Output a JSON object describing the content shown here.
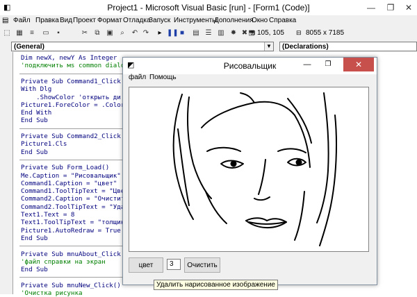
{
  "window": {
    "title": "Project1 - Microsoft Visual Basic [run] - [Form1 (Code)]",
    "controls": {
      "minimize": "—",
      "restore": "❐",
      "close": "✕"
    }
  },
  "menu": [
    "Файл",
    "Правка",
    "Вид",
    "Проект",
    "Формат",
    "Отладка",
    "Запуск",
    "Инструменты",
    "Дополнения",
    "Окно",
    "Справка"
  ],
  "toolbar": {
    "icons": [
      "vb-icon",
      "add-form-icon",
      "menu-editor-icon",
      "open-icon",
      "save-icon",
      "cut-icon",
      "copy-icon",
      "paste-icon",
      "find-icon",
      "undo-icon",
      "redo-icon",
      "start-icon",
      "break-icon",
      "end-icon",
      "project-explorer-icon",
      "properties-icon",
      "form-layout-icon",
      "object-browser-icon",
      "toolbox-icon",
      "data-view-icon"
    ],
    "position": "105, 105",
    "size": "8055 x 7185"
  },
  "code_window": {
    "object_combo": "(General)",
    "proc_combo": "(Declarations)",
    "lines": [
      {
        "text": "Dim newX, newY As Integer",
        "type": "code"
      },
      {
        "text": "'подключить мs common dialo",
        "type": "comment"
      },
      {
        "text": "",
        "type": "sep"
      },
      {
        "text": "Private Sub Command1_Click",
        "type": "code"
      },
      {
        "text": "With Dlg",
        "type": "code"
      },
      {
        "text": "    .ShowColor 'открыть ди",
        "type": "code"
      },
      {
        "text": "Picture1.ForeColor = .Color",
        "type": "code"
      },
      {
        "text": "End With",
        "type": "code"
      },
      {
        "text": "End Sub",
        "type": "code"
      },
      {
        "text": "",
        "type": "sep"
      },
      {
        "text": "Private Sub Command2_Click",
        "type": "code"
      },
      {
        "text": "Picture1.Cls",
        "type": "code"
      },
      {
        "text": "End Sub",
        "type": "code"
      },
      {
        "text": "",
        "type": "sep"
      },
      {
        "text": "Private Sub Form_Load()",
        "type": "code"
      },
      {
        "text": "Me.Caption = \"Рисовальщик\"",
        "type": "code"
      },
      {
        "text": "Command1.Caption = \"цвет\"",
        "type": "code"
      },
      {
        "text": "Command1.ToolTipText = \"Цве",
        "type": "code"
      },
      {
        "text": "Command2.Caption = \"Очистит",
        "type": "code"
      },
      {
        "text": "Command2.ToolTipText = \"Уда",
        "type": "code"
      },
      {
        "text": "Text1.Text = 8",
        "type": "code"
      },
      {
        "text": "Text1.ToolTipText = \"толщин",
        "type": "code"
      },
      {
        "text": "Picture1.AutoRedraw = True",
        "type": "code"
      },
      {
        "text": "End Sub",
        "type": "code"
      },
      {
        "text": "",
        "type": "sep"
      },
      {
        "text": "Private Sub mnuAbout_Click",
        "type": "code"
      },
      {
        "text": "'файл справки на экран",
        "type": "comment"
      },
      {
        "text": "End Sub",
        "type": "code"
      },
      {
        "text": "",
        "type": "sep"
      },
      {
        "text": "Private Sub mnuNew_Click()",
        "type": "code"
      },
      {
        "text": "'Очистка рисунка",
        "type": "comment"
      }
    ]
  },
  "form": {
    "title": "Рисовальщик",
    "menu": [
      "файл",
      "Помощь"
    ],
    "color_button": "цвет",
    "thickness_value": "3",
    "clear_button": "Очистить",
    "tooltip": "Удалить нарисованное изображение"
  }
}
